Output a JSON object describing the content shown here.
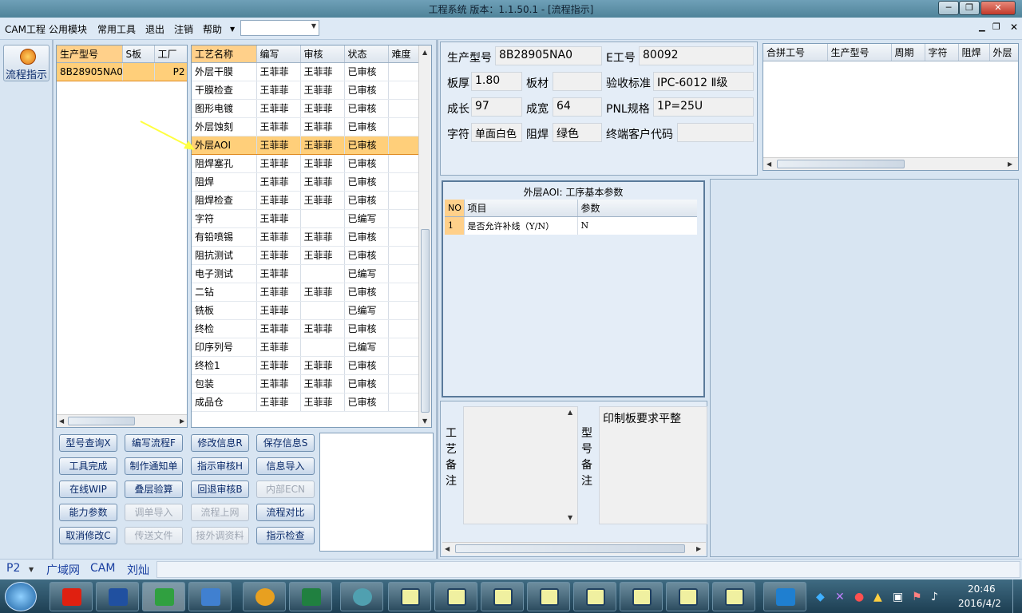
{
  "window": {
    "title": "工程系统   版本：1.1.50.1 - [流程指示]"
  },
  "menu": {
    "items": [
      "CAM工程",
      "公用模块",
      "常用工具",
      "退出",
      "注销",
      "帮助"
    ]
  },
  "side": {
    "button_label": "流程指示"
  },
  "model_grid": {
    "columns": [
      "生产型号",
      "S板",
      "工厂"
    ],
    "rows": [
      [
        "8B28905NA0",
        "",
        "P2"
      ]
    ]
  },
  "process_grid": {
    "columns": [
      "工艺名称",
      "编写",
      "审核",
      "状态",
      "难度"
    ],
    "rows": [
      [
        "外层干膜",
        "王菲菲",
        "王菲菲",
        "已审核",
        ""
      ],
      [
        "干膜检查",
        "王菲菲",
        "王菲菲",
        "已审核",
        ""
      ],
      [
        "图形电镀",
        "王菲菲",
        "王菲菲",
        "已审核",
        ""
      ],
      [
        "外层蚀刻",
        "王菲菲",
        "王菲菲",
        "已审核",
        ""
      ],
      [
        "外层AOI",
        "王菲菲",
        "王菲菲",
        "已审核",
        ""
      ],
      [
        "阻焊塞孔",
        "王菲菲",
        "王菲菲",
        "已审核",
        ""
      ],
      [
        "阻焊",
        "王菲菲",
        "王菲菲",
        "已审核",
        ""
      ],
      [
        "阻焊检查",
        "王菲菲",
        "王菲菲",
        "已审核",
        ""
      ],
      [
        "字符",
        "王菲菲",
        "",
        "已编写",
        ""
      ],
      [
        "有铅喷锡",
        "王菲菲",
        "王菲菲",
        "已审核",
        ""
      ],
      [
        "阻抗测试",
        "王菲菲",
        "王菲菲",
        "已审核",
        ""
      ],
      [
        "电子测试",
        "王菲菲",
        "",
        "已编写",
        ""
      ],
      [
        "二钻",
        "王菲菲",
        "王菲菲",
        "已审核",
        ""
      ],
      [
        "铣板",
        "王菲菲",
        "",
        "已编写",
        ""
      ],
      [
        "终检",
        "王菲菲",
        "王菲菲",
        "已审核",
        ""
      ],
      [
        "印序列号",
        "王菲菲",
        "",
        "已编写",
        ""
      ],
      [
        "终检1",
        "王菲菲",
        "王菲菲",
        "已审核",
        ""
      ],
      [
        "包装",
        "王菲菲",
        "王菲菲",
        "已审核",
        ""
      ],
      [
        "成品仓",
        "王菲菲",
        "王菲菲",
        "已审核",
        ""
      ]
    ],
    "selected_index": 4
  },
  "buttons": [
    [
      "型号查询X",
      "编写流程F",
      "修改信息R",
      "保存信息S"
    ],
    [
      "工具完成",
      "制作通知单",
      "指示审核H",
      "信息导入"
    ],
    [
      "在线WIP",
      "叠层验算",
      "回退审核B",
      "内部ECN"
    ],
    [
      "能力参数",
      "调单导入",
      "流程上网",
      "流程对比"
    ],
    [
      "取消修改C",
      "传送文件",
      "接外调资料",
      "指示检查"
    ]
  ],
  "disabled_buttons": [
    "内部ECN",
    "调单导入",
    "流程上网",
    "传送文件",
    "接外调资料"
  ],
  "info": {
    "model_label": "生产型号",
    "model": "8B28905NA0",
    "e_label": "E工号",
    "e_no": "80092",
    "thick_label": "板厚",
    "thick": "1.80",
    "mat_label": "板材",
    "mat": "",
    "std_label": "验收标准",
    "std": "IPC-6012 Ⅱ级",
    "len_label": "成长",
    "len": "97",
    "wid_label": "成宽",
    "wid": "64",
    "pnl_label": "PNL规格",
    "pnl": "1P=25U",
    "char_label": "字符",
    "char": "单面白色",
    "mask_label": "阻焊",
    "mask": "绿色",
    "cust_label": "终端客户代码",
    "cust": ""
  },
  "merge_grid": {
    "columns": [
      "合拼工号",
      "生产型号",
      "周期",
      "字符",
      "阻焊",
      "外层"
    ]
  },
  "params": {
    "title": "外层AOI: 工序基本参数",
    "columns": [
      "NO",
      "项目",
      "参数"
    ],
    "rows": [
      [
        "1",
        "是否允许补线（Y/N）",
        "N"
      ]
    ]
  },
  "notes": {
    "process_label": "工艺备注",
    "process_text": "",
    "model_label": "型号备注",
    "model_text": "印制板要求平整"
  },
  "status": {
    "factory": "P2",
    "net": "广域网",
    "dept": "CAM",
    "user": "刘灿"
  },
  "taskbar": {
    "time": "20:46",
    "date": "2016/4/2"
  },
  "colors": {
    "selected_row": "#ffcf7a",
    "arrow": "#ffff40"
  }
}
